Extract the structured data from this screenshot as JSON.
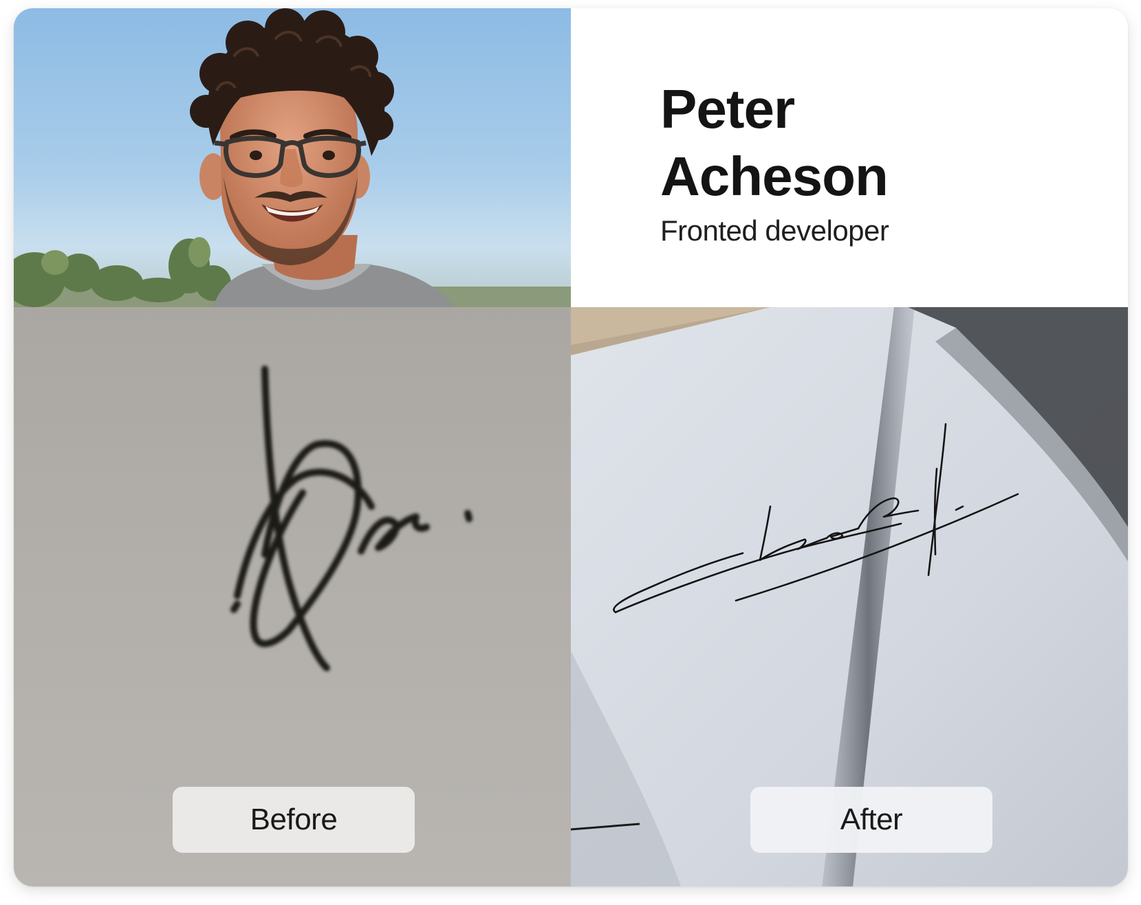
{
  "profile": {
    "first_name": "Peter",
    "last_name": "Acheson",
    "role": "Fronted developer"
  },
  "comparison": {
    "before_label": "Before",
    "after_label": "After"
  }
}
